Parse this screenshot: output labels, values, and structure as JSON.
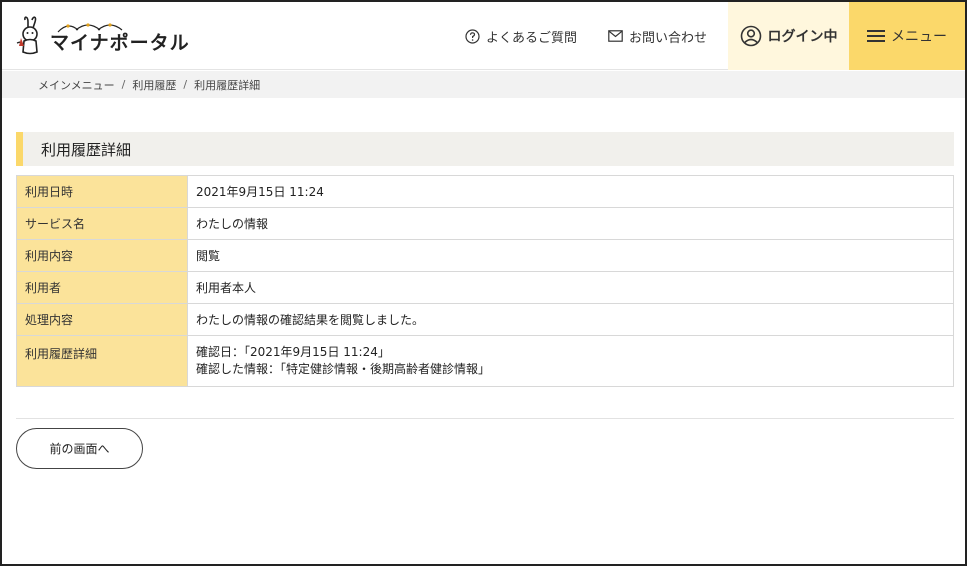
{
  "header": {
    "logo_text": "マイナポータル",
    "faq_label": "よくあるご質問",
    "contact_label": "お問い合わせ",
    "login_label": "ログイン中",
    "menu_label": "メニュー"
  },
  "breadcrumb": {
    "items": [
      "メインメニュー",
      "利用履歴",
      "利用履歴詳細"
    ],
    "separator": "/"
  },
  "section": {
    "title": "利用履歴詳細"
  },
  "table": {
    "rows": [
      {
        "label": "利用日時",
        "value": "2021年9月15日 11:24"
      },
      {
        "label": "サービス名",
        "value": "わたしの情報"
      },
      {
        "label": "利用内容",
        "value": "閲覧"
      },
      {
        "label": "利用者",
        "value": "利用者本人"
      },
      {
        "label": "処理内容",
        "value": "わたしの情報の確認結果を閲覧しました。"
      },
      {
        "label": "利用履歴詳細",
        "value_lines": [
          "確認日：「2021年9月15日 11:24」",
          "確認した情報：「特定健診情報・後期高齢者健診情報」"
        ]
      }
    ]
  },
  "actions": {
    "back_label": "前の画面へ"
  },
  "colors": {
    "accent_yellow": "#fbd86a",
    "header_label_bg": "#fbe39a",
    "login_bg": "#fff7dd"
  },
  "icons": {
    "logo": "mynaportal-rabbit-logo",
    "faq": "question-circle-icon",
    "contact": "envelope-icon",
    "login": "user-circle-icon",
    "menu": "hamburger-icon"
  }
}
